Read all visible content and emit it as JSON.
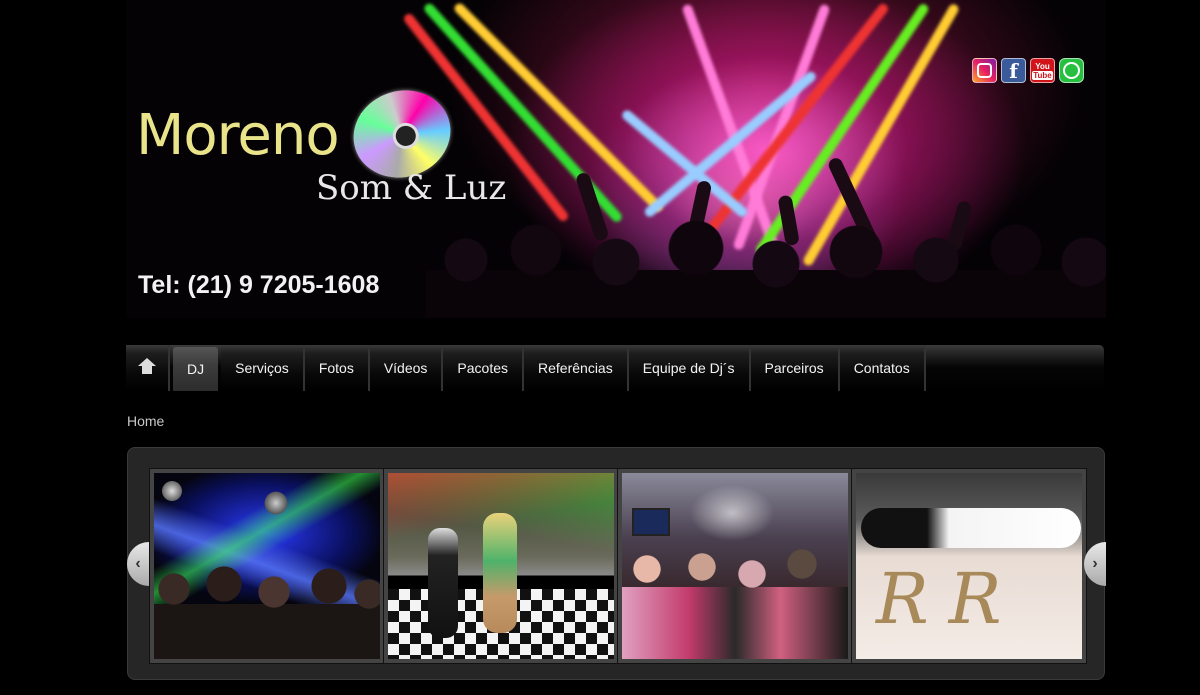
{
  "header": {
    "brand_title": "Moreno Dj",
    "brand_subtitle": "Som & Luz",
    "phone": "Tel: (21) 9 7205-1608"
  },
  "social": [
    {
      "name": "instagram-icon",
      "glyph": ""
    },
    {
      "name": "facebook-icon",
      "glyph": "f"
    },
    {
      "name": "youtube-icon",
      "glyph_top": "You",
      "glyph_bottom": "Tube"
    },
    {
      "name": "whatsapp-icon",
      "glyph": ""
    }
  ],
  "nav": {
    "home_icon": "home-icon",
    "items": [
      "DJ",
      "Serviços",
      "Fotos",
      "Vídeos",
      "Pacotes",
      "Referências",
      "Equipe de Dj´s",
      "Parceiros",
      "Contatos"
    ],
    "active_index": 0
  },
  "breadcrumb": "Home",
  "gallery": {
    "prev_arrow": "‹",
    "next_arrow": "›",
    "photos": [
      {
        "name": "photo-club-lasers"
      },
      {
        "name": "photo-samba-dancer"
      },
      {
        "name": "photo-party-crowd"
      },
      {
        "name": "photo-couple-dancefloor"
      }
    ]
  },
  "colors": {
    "background": "#000000",
    "logo_yellow": "#e9e38a",
    "nav_text": "#f3f3f3"
  }
}
